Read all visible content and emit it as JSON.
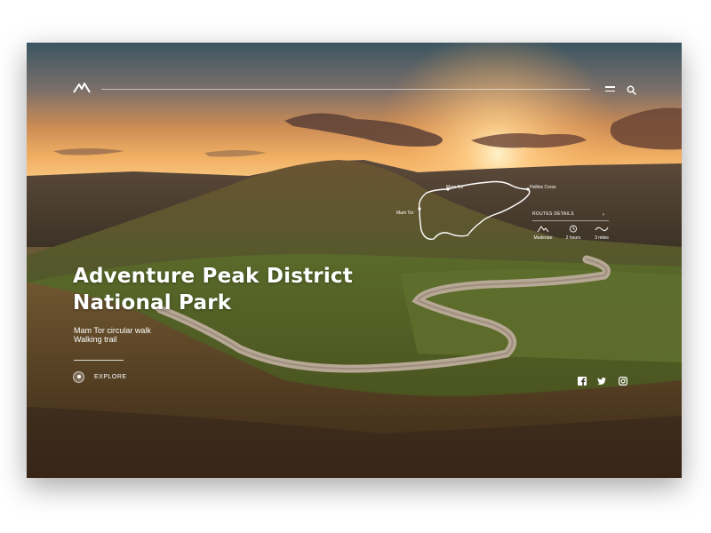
{
  "hero": {
    "title_line1": "Adventure Peak District",
    "title_line2": "National Park",
    "subtitle_line1": "Mam Tor circular walk",
    "subtitle_line2": "Walking trail",
    "explore_label": "EXPLORE"
  },
  "header": {
    "logo_icon": "mountain-logo-icon",
    "menu_icon": "hamburger-menu-icon",
    "search_icon": "search-icon"
  },
  "route_map": {
    "labels": [
      "Mam Tor",
      "Mam Tor",
      "Hollins Cross"
    ],
    "details_title": "ROUTES DETAILS",
    "stats": [
      {
        "icon": "elevation-icon",
        "label": "Moderate"
      },
      {
        "icon": "clock-icon",
        "label": "2 hours"
      },
      {
        "icon": "distance-icon",
        "label": "3 miles"
      }
    ]
  },
  "social": [
    "facebook-icon",
    "twitter-icon",
    "instagram-icon"
  ],
  "colors": {
    "sky_top": "#3c5560",
    "sunset": "#f3b46a",
    "hills": "#6a5836",
    "text": "#ffffff"
  }
}
